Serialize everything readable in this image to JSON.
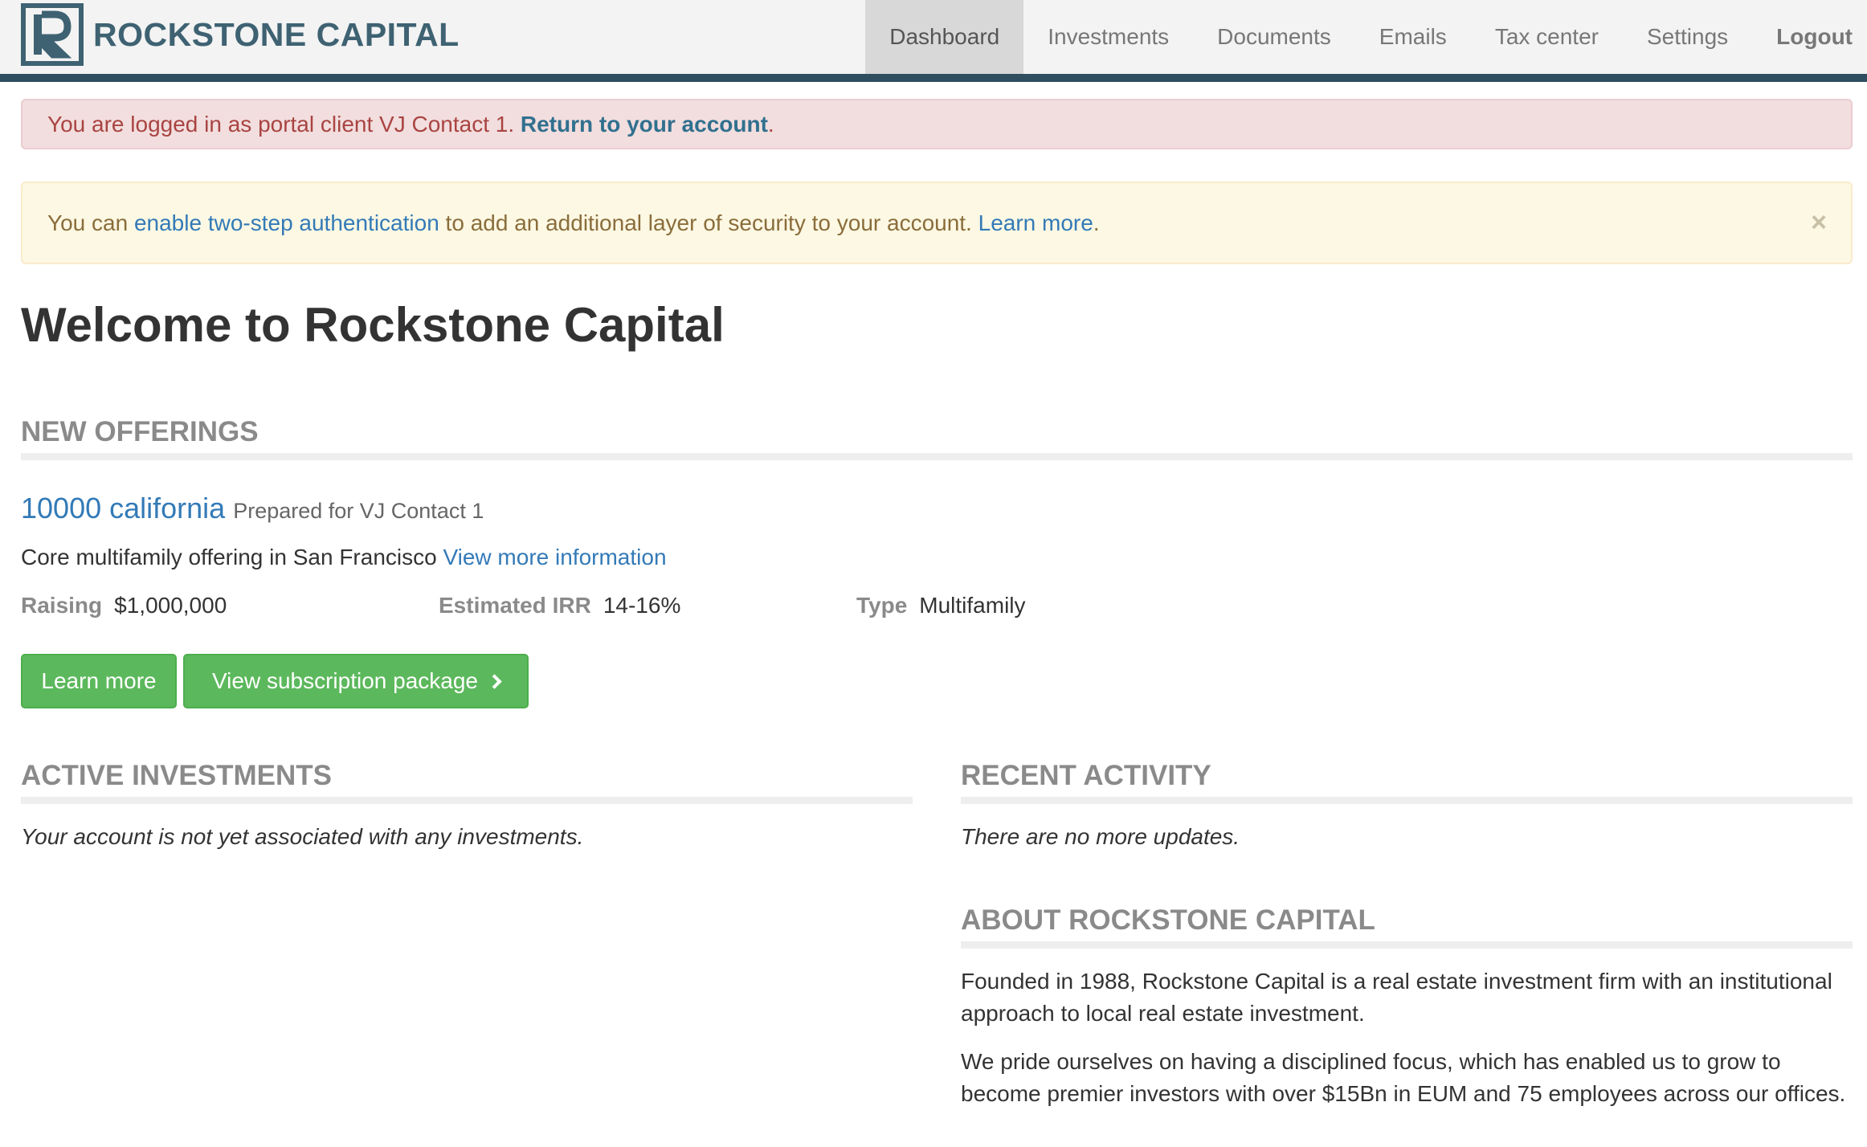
{
  "brand": {
    "name": "ROCKSTONE CAPITAL",
    "logo_letter": "R",
    "logo_color": "#3e6272"
  },
  "nav": {
    "items": [
      {
        "label": "Dashboard",
        "active": true
      },
      {
        "label": "Investments"
      },
      {
        "label": "Documents"
      },
      {
        "label": "Emails"
      },
      {
        "label": "Tax center"
      },
      {
        "label": "Settings"
      },
      {
        "label": "Logout"
      }
    ]
  },
  "alerts": {
    "impersonation": {
      "text": "You are logged in as portal client VJ Contact 1. ",
      "link": "Return to your account",
      "suffix": "."
    },
    "two_step": {
      "prefix": "You can ",
      "link": "enable two-step authentication",
      "middle": " to add an additional layer of security to your account. ",
      "learn_more": "Learn more",
      "suffix": ".",
      "close": "×"
    }
  },
  "page_title": "Welcome to Rockstone Capital",
  "new_offerings": {
    "header": "NEW OFFERINGS",
    "offering": {
      "name": "10000 california",
      "prepared_for": "Prepared for VJ Contact 1",
      "description": "Core multifamily offering in San Francisco ",
      "more_link": "View more information",
      "stats": [
        {
          "label": "Raising",
          "value": "$1,000,000"
        },
        {
          "label": "Estimated IRR",
          "value": "14-16%"
        },
        {
          "label": "Type",
          "value": "Multifamily"
        }
      ],
      "learn_more_button": "Learn more",
      "subscription_button": "View subscription package"
    }
  },
  "active_investments": {
    "header": "ACTIVE INVESTMENTS",
    "empty": "Your account is not yet associated with any investments."
  },
  "recent_activity": {
    "header": "RECENT ACTIVITY",
    "empty": "There are no more updates."
  },
  "about": {
    "header": "ABOUT ROCKSTONE CAPITAL",
    "paragraphs": [
      "Founded in 1988, Rockstone Capital is a real estate investment firm with an institutional approach to local real estate investment.",
      "We pride ourselves on having a disciplined focus, which has enabled us to grow to become premier investors with over $15Bn in EUM and 75 employees across our offices."
    ]
  },
  "colors": {
    "nav_border": "#2f4f61",
    "link": "#337ab7",
    "success": "#5cb85c",
    "danger_bg": "#f2dede",
    "warning_bg": "#fcf8e3"
  }
}
